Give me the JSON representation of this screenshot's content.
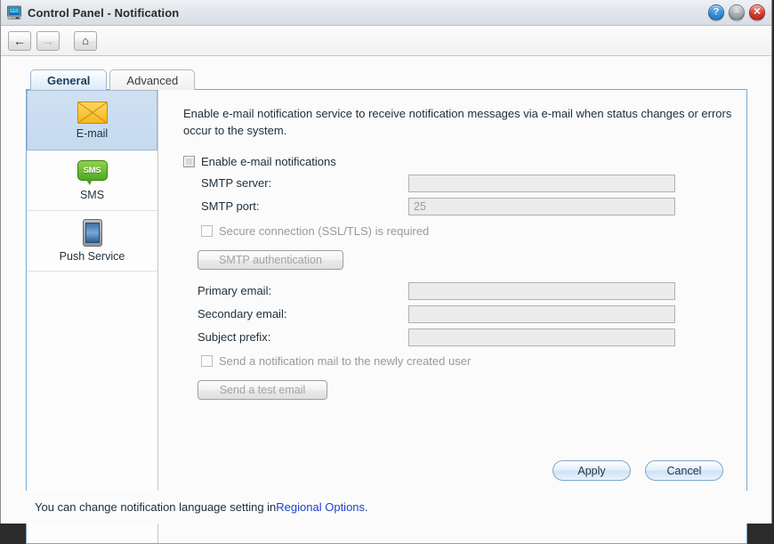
{
  "window": {
    "title": "Control Panel - Notification",
    "icon": "control-panel-icon",
    "buttons": {
      "help": "?",
      "minimize": "–",
      "close": "✕"
    }
  },
  "toolbar": {
    "back": "←",
    "forward": "→",
    "home": "⌂"
  },
  "tabs": [
    {
      "label": "General",
      "active": true
    },
    {
      "label": "Advanced",
      "active": false
    }
  ],
  "sidebar": {
    "items": [
      {
        "label": "E-mail",
        "icon": "envelope-icon",
        "selected": true
      },
      {
        "label": "SMS",
        "icon": "sms-bubble-icon",
        "selected": false
      },
      {
        "label": "Push Service",
        "icon": "mobile-phone-icon",
        "selected": false
      }
    ]
  },
  "main": {
    "intro": "Enable e-mail notification service to receive notification messages via e-mail when status changes or errors occur to the system.",
    "enable_checkbox": "Enable e-mail notifications",
    "smtp_server_label": "SMTP server:",
    "smtp_server_value": "",
    "smtp_port_label": "SMTP port:",
    "smtp_port_value": "25",
    "secure_checkbox": "Secure connection (SSL/TLS) is required",
    "smtp_auth_button": "SMTP authentication",
    "primary_email_label": "Primary email:",
    "primary_email_value": "",
    "secondary_email_label": "Secondary email:",
    "secondary_email_value": "",
    "subject_prefix_label": "Subject prefix:",
    "subject_prefix_value": "",
    "notify_new_user_checkbox": "Send a notification mail to the newly created user",
    "test_email_button": "Send a test email",
    "apply_button": "Apply",
    "cancel_button": "Cancel"
  },
  "footer": {
    "text_before": "You can change notification language setting in ",
    "link": "Regional Options",
    "text_after": "."
  },
  "colors": {
    "accent": "#7aa7cd",
    "link": "#2142c7",
    "selected_item": "#c5daf0"
  }
}
